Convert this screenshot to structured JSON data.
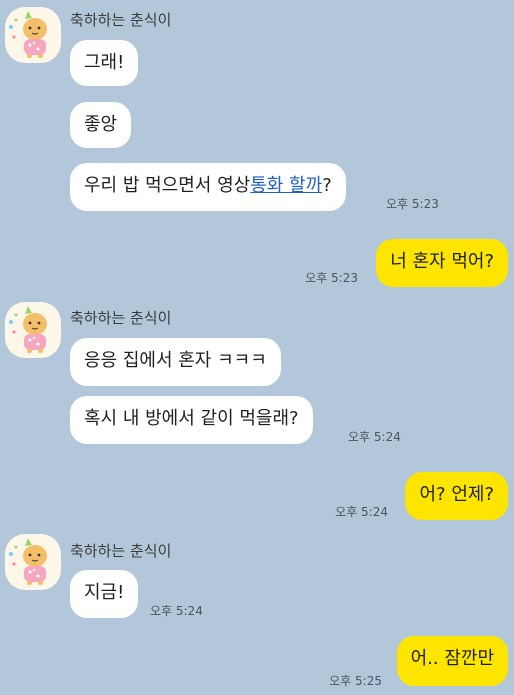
{
  "contact": {
    "name": "축하하는 춘식이",
    "avatar_icon": "chunsik-character-icon"
  },
  "colors": {
    "background": "#b2c7d9",
    "received_bubble": "#ffffff",
    "sent_bubble": "#fee500",
    "link": "#1f5fc6"
  },
  "messages": [
    {
      "from": "contact",
      "text": "그래!"
    },
    {
      "from": "contact",
      "text": "좋앙"
    },
    {
      "from": "contact",
      "text_before": "우리 밥 먹으면서 영상",
      "link_text": "통화 할까",
      "text_after": "?",
      "time": "오후 5:23"
    },
    {
      "from": "me",
      "text": "너 혼자 먹어?",
      "time": "오후 5:23"
    },
    {
      "from": "contact",
      "text": "응응 집에서 혼자 ㅋㅋㅋ"
    },
    {
      "from": "contact",
      "text": "혹시 내 방에서 같이 먹을래?",
      "time": "오후 5:24"
    },
    {
      "from": "me",
      "text": "어? 언제?",
      "time": "오후 5:24"
    },
    {
      "from": "contact",
      "text": "지금!",
      "time": "오후 5:24"
    },
    {
      "from": "me",
      "text": "어.. 잠깐만",
      "time": "오후 5:25"
    }
  ]
}
